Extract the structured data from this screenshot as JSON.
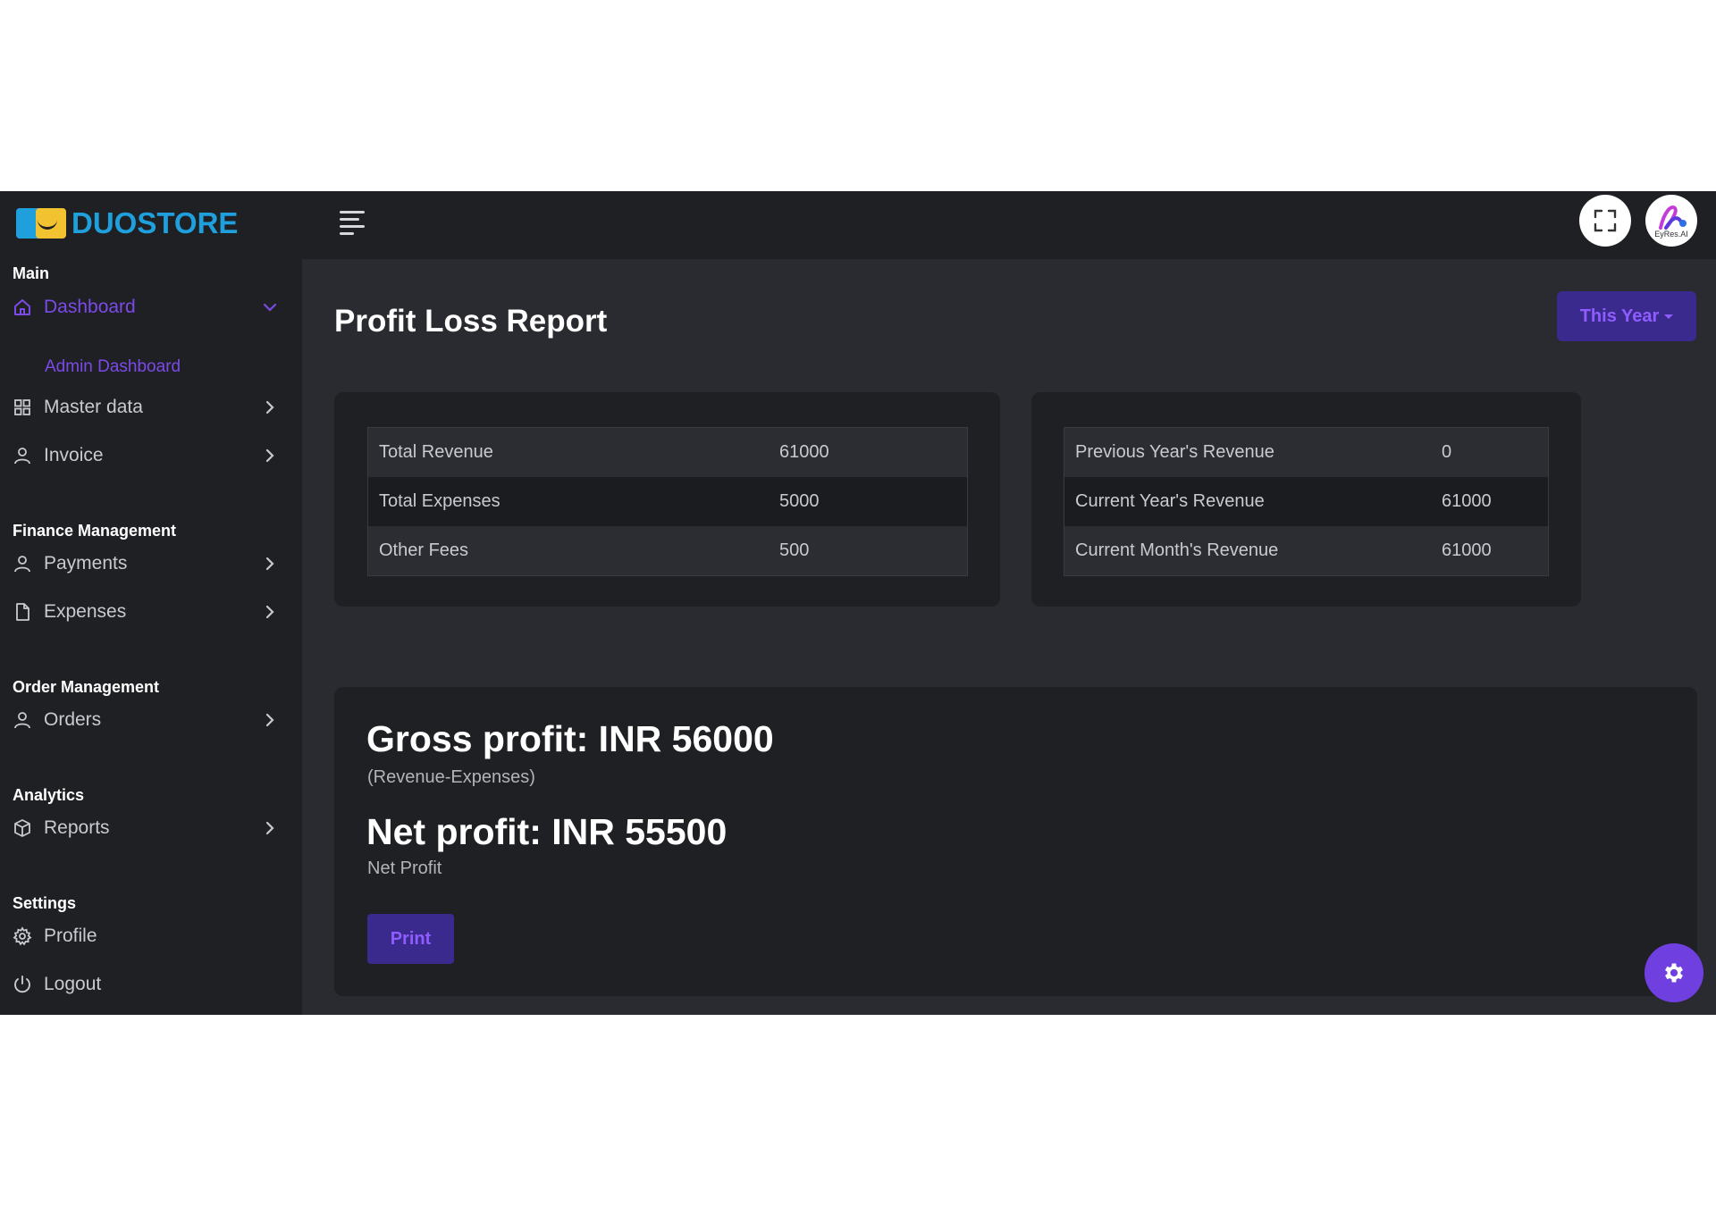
{
  "brand": {
    "name": "DUOSTORE"
  },
  "header": {
    "avatar_label": "EyRes.AI"
  },
  "sidebar": {
    "sections": {
      "main": "Main",
      "finance": "Finance Management",
      "order": "Order Management",
      "analytics": "Analytics",
      "settings": "Settings"
    },
    "items": {
      "dashboard": "Dashboard",
      "admin_dashboard": "Admin Dashboard",
      "master_data": "Master data",
      "invoice": "Invoice",
      "payments": "Payments",
      "expenses": "Expenses",
      "orders": "Orders",
      "reports": "Reports",
      "profile": "Profile",
      "logout": "Logout"
    }
  },
  "page": {
    "title": "Profit Loss Report",
    "period_filter": "This Year"
  },
  "summary_left": [
    {
      "label": "Total Revenue",
      "value": "61000"
    },
    {
      "label": "Total Expenses",
      "value": "5000"
    },
    {
      "label": "Other Fees",
      "value": "500"
    }
  ],
  "summary_right": [
    {
      "label": "Previous Year's Revenue",
      "value": "0"
    },
    {
      "label": "Current Year's Revenue",
      "value": "61000"
    },
    {
      "label": "Current Month's Revenue",
      "value": "61000"
    }
  ],
  "profit": {
    "gross": "Gross profit: INR 56000",
    "gross_note": "(Revenue-Expenses)",
    "net": "Net profit: INR 55500",
    "net_note": "Net Profit",
    "print_label": "Print"
  },
  "colors": {
    "accent": "#7b4ae8",
    "brand_blue": "#1fa0dd",
    "brand_yellow": "#f2c230",
    "panel": "#1f2024",
    "background": "#2a2b30"
  }
}
